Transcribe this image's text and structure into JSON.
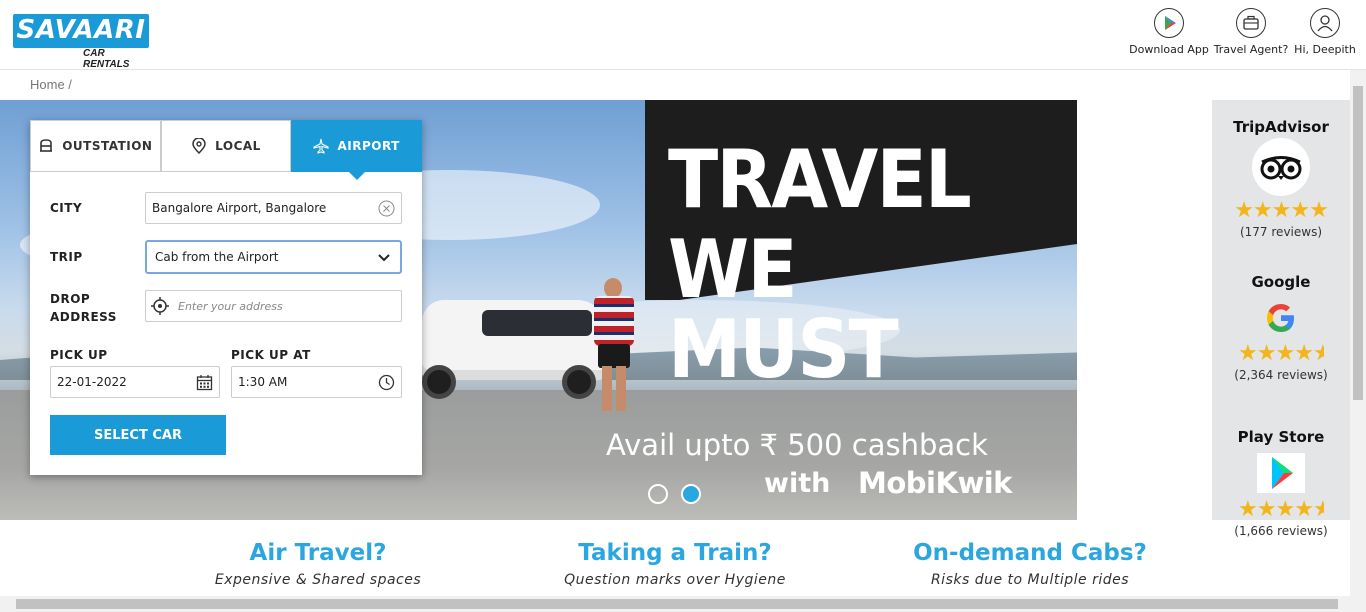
{
  "brand": {
    "name": "SAVAARI",
    "tagline": "CAR RENTALS",
    "color": "#1a9ad6"
  },
  "header": {
    "nav": [
      {
        "label": "Download App",
        "icon": "play-store-icon"
      },
      {
        "label": "Travel Agent?",
        "icon": "briefcase-icon"
      },
      {
        "label": "Hi, Deepith",
        "icon": "user-icon"
      }
    ]
  },
  "breadcrumb": {
    "home": "Home /"
  },
  "booking": {
    "tabs": [
      {
        "label": "OUTSTATION",
        "icon": "car-icon",
        "active": false
      },
      {
        "label": "LOCAL",
        "icon": "location-pin-icon",
        "active": false
      },
      {
        "label": "AIRPORT",
        "icon": "airplane-icon",
        "active": true
      }
    ],
    "city": {
      "label": "CITY",
      "value": "Bangalore Airport, Bangalore"
    },
    "trip": {
      "label": "TRIP",
      "value": "Cab from the Airport"
    },
    "drop": {
      "label_line1": "DROP",
      "label_line2": "ADDRESS",
      "placeholder": "Enter your address"
    },
    "pickup": {
      "label": "PICK UP",
      "value": "22-01-2022"
    },
    "pickup_at": {
      "label": "PICK UP AT",
      "value": "1:30 AM"
    },
    "submit": "SELECT CAR"
  },
  "banner": {
    "headline_1": "TRAVEL",
    "headline_2": "WE MUST",
    "cashback": "Avail upto ₹ 500 cashback",
    "with": "with",
    "partner": "MobiKwik",
    "slides": 2,
    "active_slide": 2
  },
  "ratings": [
    {
      "title": "TripAdvisor",
      "logo": "tripadvisor-owl-icon",
      "stars": 5,
      "count": "(177 reviews)"
    },
    {
      "title": "Google",
      "logo": "google-g-icon",
      "stars": 4.5,
      "count": "(2,364 reviews)"
    },
    {
      "title": "Play Store",
      "logo": "play-store-icon",
      "stars": 4.5,
      "count": "(1,666 reviews)"
    }
  ],
  "features": [
    {
      "title": "Air Travel?",
      "subtitle": "Expensive & Shared spaces"
    },
    {
      "title": "Taking a Train?",
      "subtitle": "Question marks over Hygiene"
    },
    {
      "title": "On-demand Cabs?",
      "subtitle": "Risks due to Multiple rides"
    }
  ],
  "colors": {
    "accent": "#1a9ad6",
    "star": "#f2b51c",
    "feature_title": "#2ba6df"
  }
}
